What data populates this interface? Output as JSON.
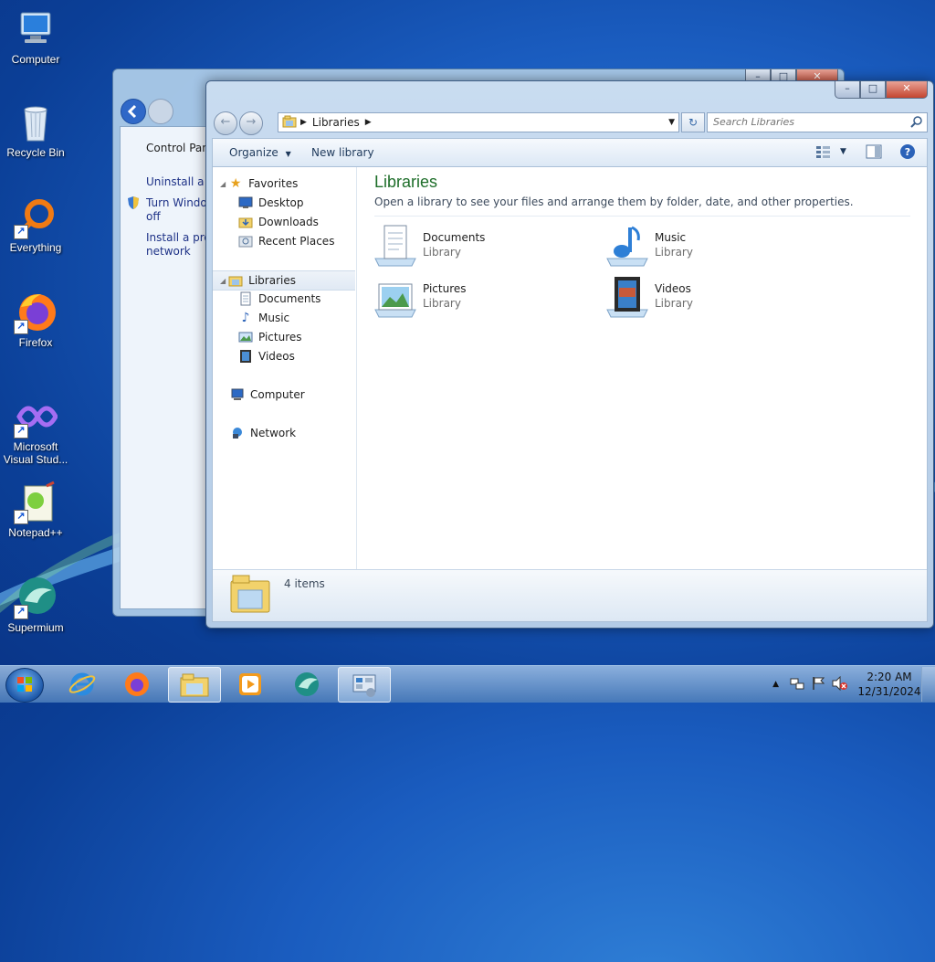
{
  "desktop": {
    "icons": [
      {
        "label": "Computer"
      },
      {
        "label": "Recycle Bin"
      },
      {
        "label": "Everything"
      },
      {
        "label": "Firefox"
      },
      {
        "label": "Microsoft Visual Stud..."
      },
      {
        "label": "Notepad++"
      },
      {
        "label": "Supermium"
      }
    ]
  },
  "back_window": {
    "links": [
      "Control Pane",
      "Uninstall a p",
      "Turn Windov",
      "off",
      "Install a prog",
      "network"
    ]
  },
  "explorer": {
    "window_controls": {
      "minimize": "–",
      "maximize": "□",
      "close": "✕"
    },
    "address": {
      "crumb": "Libraries"
    },
    "search": {
      "placeholder": "Search Libraries"
    },
    "toolbar": {
      "organize": "Organize",
      "new_library": "New library"
    },
    "nav": {
      "favorites": "Favorites",
      "desktop": "Desktop",
      "downloads": "Downloads",
      "recent": "Recent Places",
      "libraries": "Libraries",
      "documents": "Documents",
      "music": "Music",
      "pictures": "Pictures",
      "videos": "Videos",
      "computer": "Computer",
      "network": "Network"
    },
    "main": {
      "title": "Libraries",
      "description": "Open a library to see your files and arrange them by folder, date, and other properties.",
      "items": [
        {
          "name": "Documents",
          "type": "Library"
        },
        {
          "name": "Music",
          "type": "Library"
        },
        {
          "name": "Pictures",
          "type": "Library"
        },
        {
          "name": "Videos",
          "type": "Library"
        }
      ]
    },
    "status": {
      "count": "4 items"
    }
  },
  "taskbar": {
    "clock_time": "2:20 AM",
    "clock_date": "12/31/2024"
  },
  "colors": {
    "title_green": "#1e6e2a",
    "link_blue": "#1e3287",
    "accent": "#2f68c8"
  }
}
